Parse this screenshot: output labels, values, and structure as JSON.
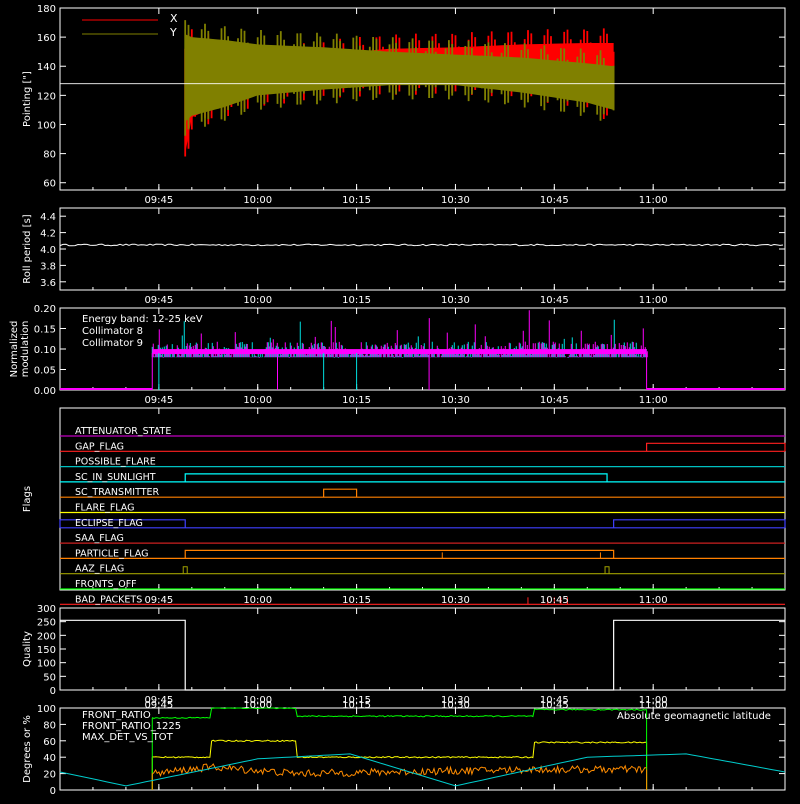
{
  "colors": {
    "background": "#000000",
    "axes": "#ffffff",
    "pointing_x": "#ff0000",
    "pointing_y": "#808000",
    "roll": "#ffffff",
    "coll8": "#00e0e0",
    "coll9": "#ff00ff",
    "quality": "#ffffff",
    "front_ratio": "#ffff00",
    "front_ratio_1225": "#00ff00",
    "max_det": "#ff8c00",
    "geomag": "#00cccc"
  },
  "time_ticks": [
    "09:45",
    "10:00",
    "10:15",
    "10:30",
    "10:45",
    "11:00"
  ],
  "chart_data": [
    {
      "type": "area",
      "panel": "pointing",
      "ylabel": "Pointing [\"]",
      "ylim": [
        55,
        180
      ],
      "yticks": [
        "60",
        "80",
        "100",
        "120",
        "140",
        "160",
        "180"
      ],
      "legend": [
        "X",
        "Y"
      ],
      "legend_placement": "top-left",
      "reference_level": 128,
      "series": [
        {
          "name": "X",
          "x": [
            "09:49",
            "09:50",
            "09:55",
            "10:00",
            "10:10",
            "10:20",
            "10:30",
            "10:40",
            "10:50",
            "10:54"
          ],
          "upper": [
            160,
            167,
            158,
            152,
            158,
            162,
            163,
            165,
            166,
            166
          ],
          "lower": [
            70,
            95,
            105,
            112,
            118,
            120,
            121,
            118,
            110,
            100
          ]
        },
        {
          "name": "Y",
          "x": [
            "09:49",
            "09:50",
            "09:55",
            "10:00",
            "10:10",
            "10:20",
            "10:30",
            "10:40",
            "10:50",
            "10:54"
          ],
          "upper": [
            172,
            170,
            168,
            165,
            163,
            160,
            158,
            156,
            152,
            150
          ],
          "lower": [
            92,
            96,
            102,
            110,
            114,
            117,
            117,
            112,
            105,
            100
          ]
        }
      ]
    },
    {
      "type": "line",
      "panel": "roll",
      "ylabel": "Roll period [s]",
      "ylim": [
        3.5,
        4.5
      ],
      "yticks": [
        "3.6",
        "3.8",
        "4.0",
        "4.2",
        "4.4"
      ],
      "series": [
        {
          "name": "roll period",
          "value": 4.05
        }
      ]
    },
    {
      "type": "bar",
      "panel": "modulation",
      "ylabel": "Normalized modulation",
      "ylim": [
        0,
        0.2
      ],
      "yticks": [
        "0.00",
        "0.05",
        "0.10",
        "0.15",
        "0.20"
      ],
      "annotation": "Energy band: 12-25 keV",
      "legend": [
        "Collimator 8",
        "Collimator 9"
      ],
      "legend_placement": "top-left",
      "data_start": "09:44",
      "data_end": "10:59",
      "baseline": 0.09
    },
    {
      "type": "line",
      "panel": "flags",
      "ylabel": "Flags",
      "flags": [
        {
          "name": "ATTENUATOR_STATE",
          "color": "#c000c0",
          "segments": []
        },
        {
          "name": "GAP_FLAG",
          "color": "#ff2020",
          "segments": [
            [
              "10:59",
              "11:20"
            ]
          ]
        },
        {
          "name": "POSSIBLE_FLARE",
          "color": "#00c0c0",
          "segments": []
        },
        {
          "name": "SC_IN_SUNLIGHT",
          "color": "#00ffff",
          "segments": [
            [
              "09:49",
              "10:53"
            ]
          ]
        },
        {
          "name": "SC_TRANSMITTER",
          "color": "#ff8000",
          "segments": [
            [
              "10:10",
              "10:15"
            ]
          ]
        },
        {
          "name": "FLARE_FLAG",
          "color": "#ffff00",
          "segments": []
        },
        {
          "name": "ECLIPSE_FLAG",
          "color": "#4040ff",
          "segments": [
            [
              "09:30",
              "09:49"
            ],
            [
              "10:54",
              "11:20"
            ]
          ]
        },
        {
          "name": "SAA_FLAG",
          "color": "#cc2020",
          "segments": []
        },
        {
          "name": "PARTICLE_FLAG",
          "color": "#ff8000",
          "segments": [
            [
              "09:49",
              "10:54"
            ]
          ]
        },
        {
          "name": "AAZ_FLAG",
          "color": "#a0a000",
          "segments": []
        },
        {
          "name": "FRONTS_OFF",
          "color": "#00ff00",
          "segments": []
        },
        {
          "name": "BAD_PACKETS",
          "color": "#ff2020",
          "segments": []
        }
      ]
    },
    {
      "type": "line",
      "panel": "quality",
      "ylabel": "Quality",
      "ylim": [
        0,
        300
      ],
      "yticks": [
        "0",
        "50",
        "100",
        "150",
        "200",
        "250",
        "300"
      ],
      "series": [
        {
          "name": "quality",
          "x": [
            "09:30",
            "09:49",
            "09:49",
            "10:54",
            "10:54",
            "11:20"
          ],
          "y": [
            255,
            255,
            0,
            0,
            255,
            255
          ]
        }
      ]
    },
    {
      "type": "line",
      "panel": "ratios",
      "ylabel": "Degrees or %",
      "ylim": [
        0,
        100
      ],
      "yticks": [
        "0",
        "20",
        "40",
        "60",
        "80",
        "100"
      ],
      "legend": [
        "FRONT_RATIO",
        "FRONT_RATIO_1225",
        "MAX_DET_VS_TOT"
      ],
      "legend_placement": "top-left",
      "annotation": "Absolute geomagnetic latitude",
      "series": [
        {
          "name": "FRONT_RATIO",
          "x": [
            "09:44",
            "09:53",
            "09:53",
            "10:06",
            "10:06",
            "10:42",
            "10:42",
            "10:59"
          ],
          "y": [
            40,
            40,
            60,
            60,
            40,
            40,
            58,
            58
          ]
        },
        {
          "name": "FRONT_RATIO_1225",
          "x": [
            "09:44",
            "09:53",
            "09:53",
            "10:06",
            "10:06",
            "10:42",
            "10:42",
            "10:59"
          ],
          "y": [
            88,
            88,
            100,
            100,
            90,
            90,
            98,
            98
          ]
        },
        {
          "name": "MAX_DET_VS_TOT",
          "x": [
            "09:44",
            "09:53",
            "10:06",
            "10:42",
            "10:59"
          ],
          "y": [
            20,
            28,
            20,
            25,
            25
          ]
        },
        {
          "name": "Absolute geomagnetic latitude",
          "x": [
            "09:30",
            "09:40",
            "10:00",
            "10:14",
            "10:30",
            "10:50",
            "11:05",
            "11:20"
          ],
          "y": [
            22,
            5,
            38,
            44,
            5,
            40,
            44,
            22
          ]
        }
      ]
    }
  ]
}
